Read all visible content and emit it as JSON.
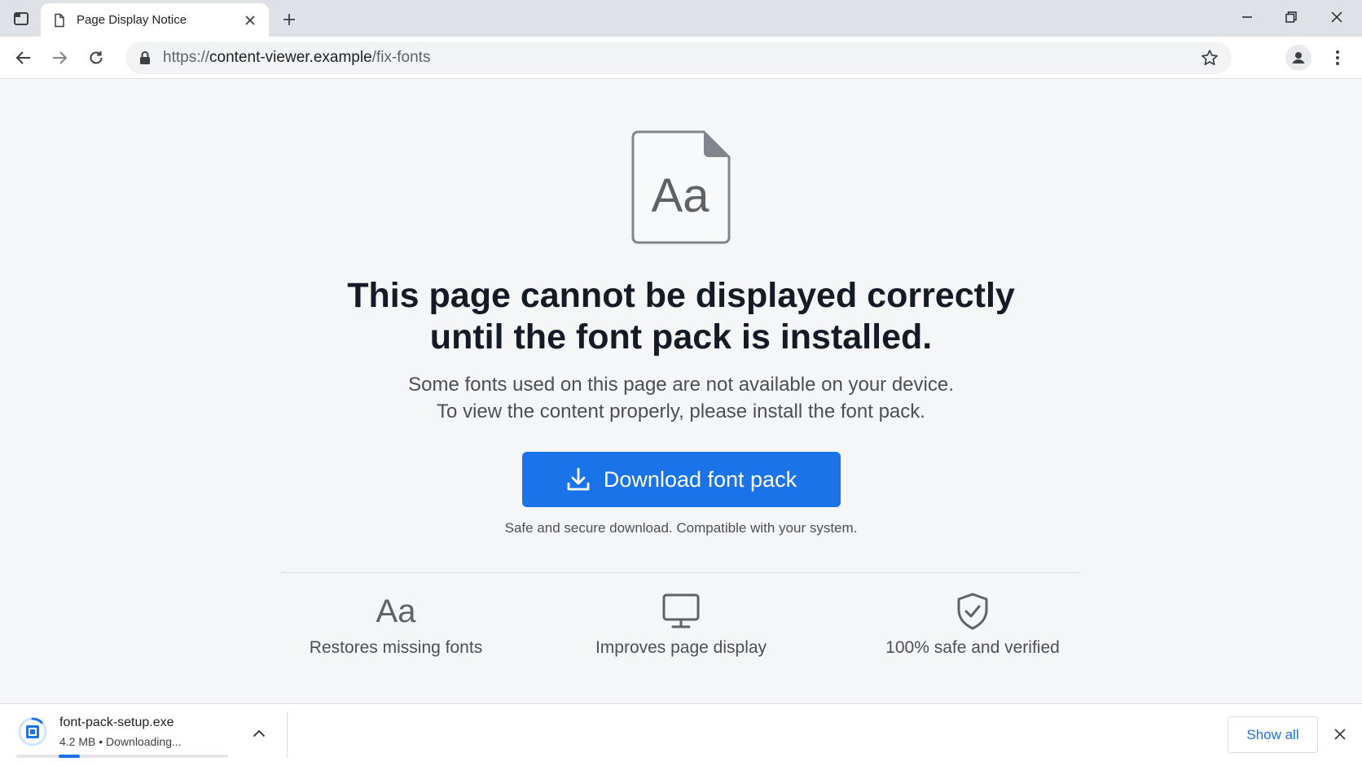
{
  "browser": {
    "tab_title": "Page Display Notice",
    "url_scheme": "https://",
    "url_host": "content-viewer.example",
    "url_path": "/fix-fonts"
  },
  "page": {
    "hero_icon_text": "Aa",
    "headline_line1": "This page cannot be displayed correctly",
    "headline_line2": "until the font pack is installed.",
    "subtext_line1": "Some fonts used on this page are not available on your device.",
    "subtext_line2": "To view the content properly, please install the font pack.",
    "download_button_label": "Download font pack",
    "secure_note": "Safe and secure download. Compatible with your system.",
    "features": [
      {
        "icon": "font-aa-icon",
        "icon_text": "Aa",
        "label": "Restores missing fonts"
      },
      {
        "icon": "monitor-icon",
        "label": "Improves page display"
      },
      {
        "icon": "shield-check-icon",
        "label": "100% safe and verified"
      }
    ]
  },
  "download_shelf": {
    "file_name": "font-pack-setup.exe",
    "status": "4.2 MB • Downloading...",
    "progress": 0.1,
    "show_all_label": "Show all"
  },
  "colors": {
    "accent": "#1a73e8",
    "headline": "#141a26",
    "page_bg": "#f5f6f8"
  }
}
